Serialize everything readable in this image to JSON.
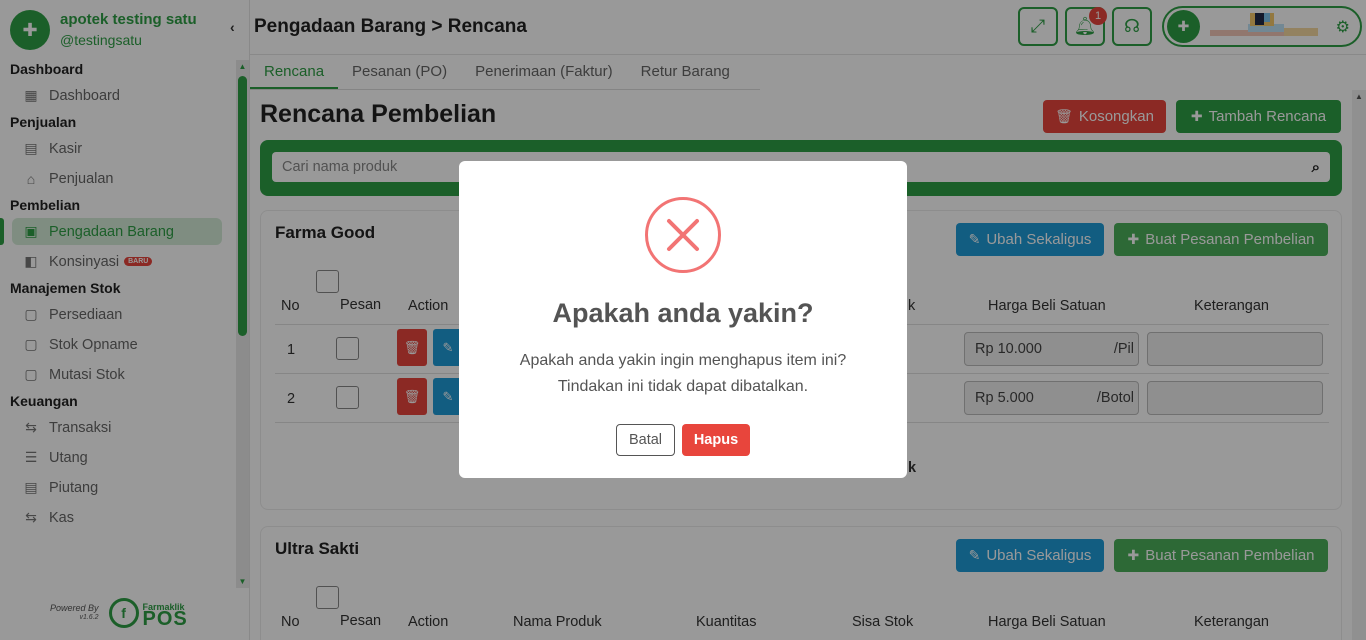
{
  "brand": {
    "name": "apotek testing satu",
    "username": "@testingsatu"
  },
  "sidebar": {
    "sections": [
      {
        "title": "Dashboard",
        "items": [
          {
            "label": "Dashboard",
            "icon": "grid-icon"
          }
        ]
      },
      {
        "title": "Penjualan",
        "items": [
          {
            "label": "Kasir",
            "icon": "cash-register-icon"
          },
          {
            "label": "Penjualan",
            "icon": "basket-icon"
          }
        ]
      },
      {
        "title": "Pembelian",
        "items": [
          {
            "label": "Pengadaan Barang",
            "icon": "procurement-icon",
            "active": true
          },
          {
            "label": "Konsinyasi",
            "icon": "handshake-icon",
            "badge": "BARU"
          }
        ]
      },
      {
        "title": "Manajemen Stok",
        "items": [
          {
            "label": "Persediaan",
            "icon": "box-icon"
          },
          {
            "label": "Stok Opname",
            "icon": "clipboard-icon"
          },
          {
            "label": "Mutasi Stok",
            "icon": "transfer-icon"
          }
        ]
      },
      {
        "title": "Keuangan",
        "items": [
          {
            "label": "Transaksi",
            "icon": "exchange-icon"
          },
          {
            "label": "Utang",
            "icon": "ledger-icon"
          },
          {
            "label": "Piutang",
            "icon": "receivable-icon"
          },
          {
            "label": "Kas",
            "icon": "cash-icon"
          }
        ]
      }
    ],
    "powered_by": "Powered By",
    "version": "v1.6.2",
    "footer_brand": "Farmaklik",
    "footer_product": "POS"
  },
  "header": {
    "title": "Pengadaan Barang > Rencana",
    "notification_count": "1"
  },
  "tabs": [
    {
      "label": "Rencana",
      "active": true
    },
    {
      "label": "Pesanan (PO)",
      "active": false
    },
    {
      "label": "Penerimaan (Faktur)",
      "active": false
    },
    {
      "label": "Retur Barang",
      "active": false
    }
  ],
  "main": {
    "heading": "Rencana Pembelian",
    "clear_label": "Kosongkan",
    "add_label": "Tambah Rencana",
    "search_placeholder": "Cari nama produk"
  },
  "table_headers": {
    "no": "No",
    "pesan": "Pesan",
    "action": "Action",
    "nama_produk": "Nama Produk",
    "kuantitas": "Kuantitas",
    "sisa_stok": "Sisa Stok",
    "harga_beli": "Harga Beli Satuan",
    "keterangan": "Keterangan"
  },
  "suppliers": [
    {
      "name": "Farma Good",
      "bulk_edit_label": "Ubah Sekaligus",
      "create_po_label": "Buat Pesanan Pembelian",
      "rows": [
        {
          "no": "1",
          "price": "Rp 10.000",
          "unit": "/Pil"
        },
        {
          "no": "2",
          "price": "Rp 5.000",
          "unit": "/Botol"
        }
      ],
      "partial_header": "k",
      "partial_footer": "k"
    },
    {
      "name": "Ultra Sakti",
      "bulk_edit_label": "Ubah Sekaligus",
      "create_po_label": "Buat Pesanan Pembelian"
    }
  ],
  "modal": {
    "title": "Apakah anda yakin?",
    "line1": "Apakah anda yakin ingin menghapus item ini?",
    "line2": "Tindakan ini tidak dapat dibatalkan.",
    "cancel_label": "Batal",
    "confirm_label": "Hapus"
  },
  "colors": {
    "brand_green": "#2e9e45",
    "danger_red": "#e8453c",
    "info_blue": "#1f9bd8",
    "error_icon": "#f27474"
  }
}
